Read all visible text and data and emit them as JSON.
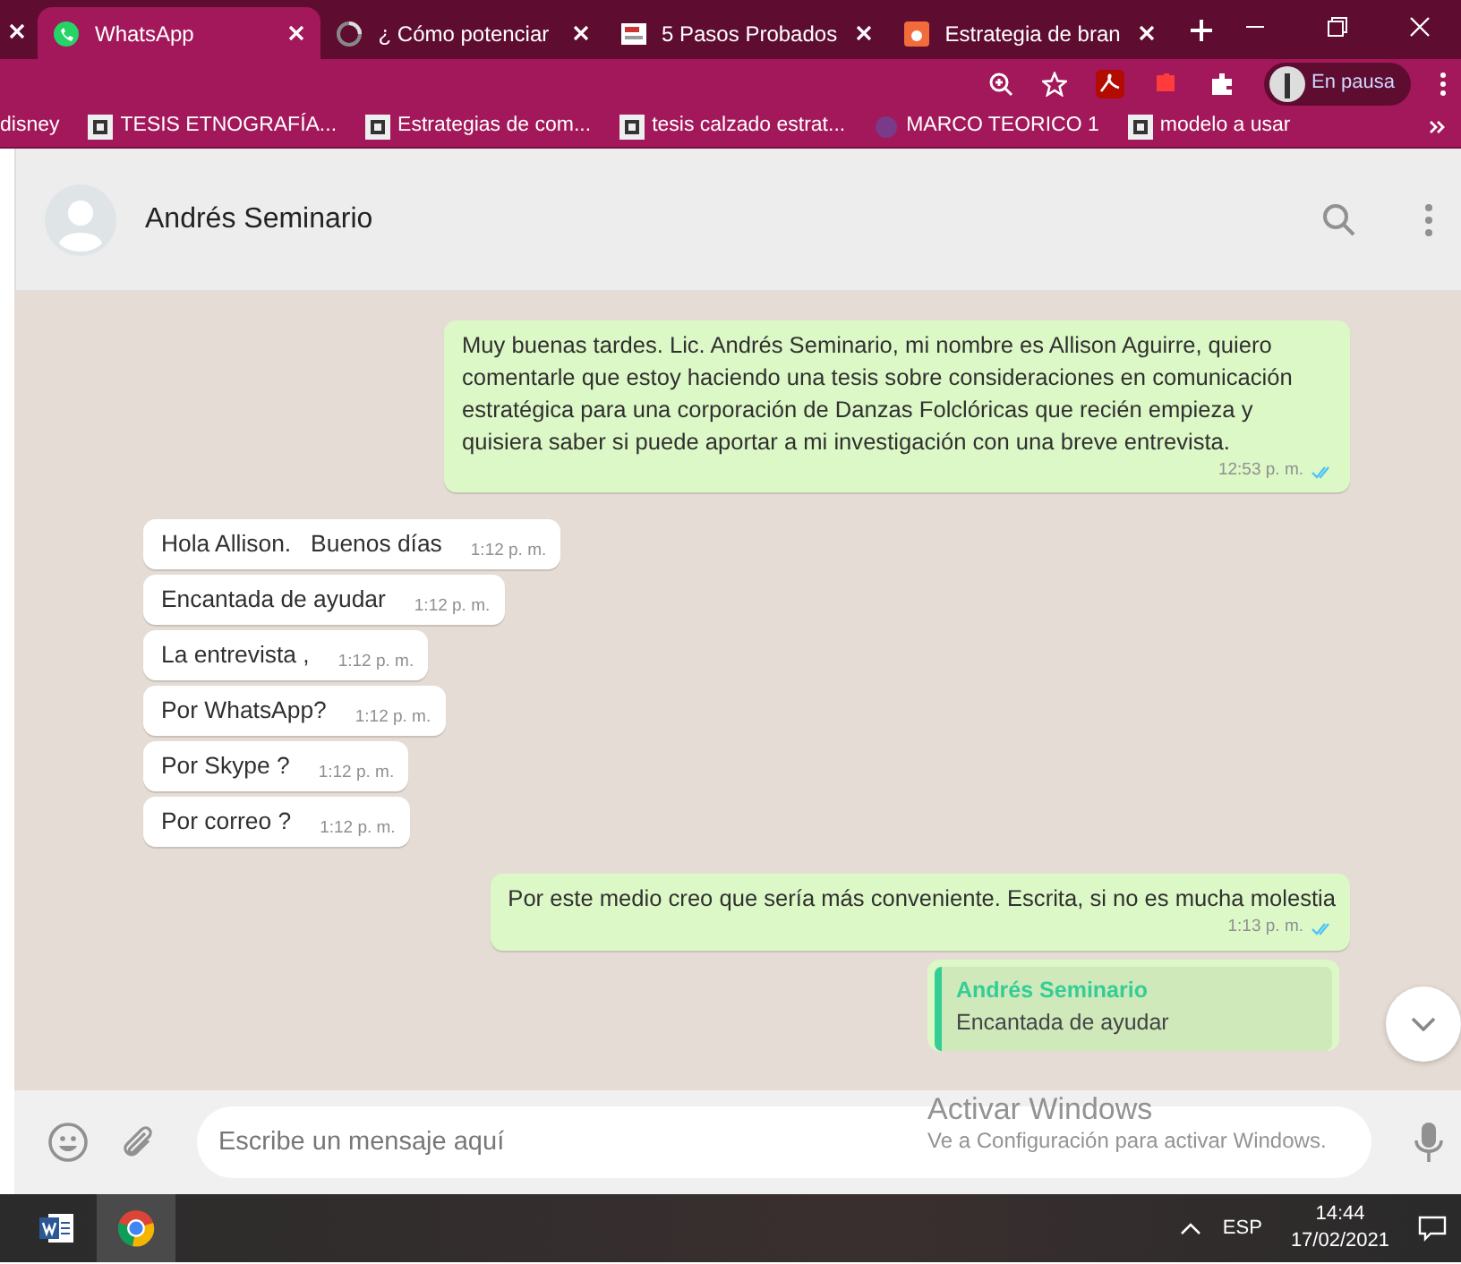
{
  "browser": {
    "tabs": [
      {
        "title": "WhatsApp",
        "selected": true,
        "kind": "whatsapp"
      },
      {
        "title": "¿ Cómo potenciar",
        "selected": false,
        "kind": "spinner"
      },
      {
        "title": "5 Pasos Probados",
        "selected": false,
        "kind": "doc"
      },
      {
        "title": "Estrategia de bran",
        "selected": false,
        "kind": "orange"
      }
    ],
    "profile": {
      "label": "En pausa"
    },
    "bookmarks": [
      {
        "title": "disney",
        "kind": "none"
      },
      {
        "title": "TESIS ETNOGRAFÍA...",
        "kind": "doc"
      },
      {
        "title": "Estrategias de com...",
        "kind": "doc"
      },
      {
        "title": "tesis calzado estrat...",
        "kind": "doc"
      },
      {
        "title": "MARCO TEORICO 1",
        "kind": "dot"
      },
      {
        "title": "modelo a usar",
        "kind": "doc"
      }
    ]
  },
  "chat": {
    "contact": "Andrés Seminario",
    "messages": [
      {
        "kind": "out",
        "text": "Muy buenas tardes. Lic. Andrés Seminario, mi nombre es Allison Aguirre, quiero comentarle que estoy haciendo una tesis sobre consideraciones en comunicación estratégica para una corporación de Danzas Folclóricas que recién empieza y quisiera saber si puede aportar a mi investigación con una breve entrevista.",
        "time": "12:53 p. m.",
        "read": true
      },
      {
        "kind": "in",
        "text": "Hola Allison.   Buenos días",
        "time": "1:12 p. m."
      },
      {
        "kind": "in",
        "text": "Encantada de ayudar",
        "time": "1:12 p. m."
      },
      {
        "kind": "in",
        "text": "La entrevista ,",
        "time": "1:12 p. m."
      },
      {
        "kind": "in",
        "text": "Por WhatsApp?",
        "time": "1:12 p. m."
      },
      {
        "kind": "in",
        "text": "Por Skype ?",
        "time": "1:12 p. m."
      },
      {
        "kind": "in",
        "text": "Por correo ?",
        "time": "1:12 p. m."
      },
      {
        "kind": "out",
        "text": "Por este medio creo que sería más conveniente. Escrita, si no es mucha molestia",
        "time": "1:13 p. m.",
        "read": true
      },
      {
        "kind": "reply",
        "author": "Andrés Seminario",
        "text": "Encantada de ayudar"
      }
    ],
    "composer": {
      "placeholder": "Escribe un mensaje aquí"
    }
  },
  "activation_notice": {
    "title": "Activar Windows",
    "text": "Ve a Configuración para activar Windows."
  },
  "taskbar": {
    "language": "ESP",
    "time": "14:44",
    "date": "17/02/2021"
  }
}
